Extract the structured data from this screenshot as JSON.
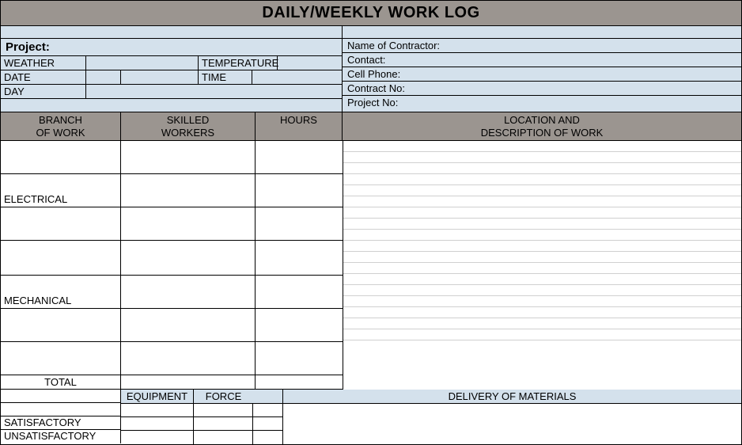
{
  "title": "DAILY/WEEKLY WORK LOG",
  "left": {
    "project": "Project:",
    "weather": "WEATHER",
    "temperature": "TEMPERATURE",
    "date": "DATE",
    "time": "TIME",
    "day": "DAY"
  },
  "right": {
    "contractor": "Name of Contractor:",
    "contact": "Contact:",
    "cellphone": "Cell Phone:",
    "contractno": "Contract No:",
    "projectno": "Project No:"
  },
  "headers": {
    "branch": "BRANCH\nOF WORK",
    "skilled": "SKILLED\nWORKERS",
    "hours": "HOURS",
    "location": "LOCATION AND\nDESCRIPTION OF WORK"
  },
  "work_rows": [
    {
      "branch": ""
    },
    {
      "branch": "ELECTRICAL"
    },
    {
      "branch": ""
    },
    {
      "branch": ""
    },
    {
      "branch": "MECHANICAL"
    },
    {
      "branch": ""
    },
    {
      "branch": ""
    }
  ],
  "total": "TOTAL",
  "bottom": {
    "equipment": "EQUIPMENT",
    "force": "FORCE",
    "delivery": "DELIVERY OF MATERIALS",
    "satisfactory": "SATISFACTORY",
    "unsatisfactory": "UNSATISFACTORY"
  }
}
